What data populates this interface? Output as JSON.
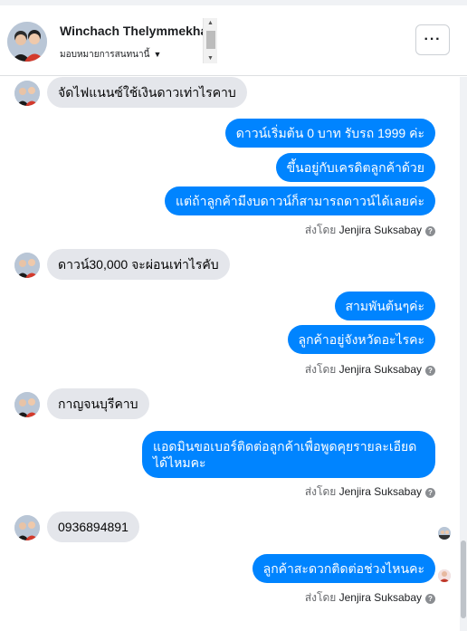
{
  "header": {
    "name": "Winchach Thelymmekha",
    "assign_label": "มอบหมายการสนทนานี้",
    "caret_icon": "caret-down-icon",
    "more_label": "···"
  },
  "messages": {
    "m1": "จัดไฟแนนซ์ใช้เงินดาวเท่าไรคาบ",
    "m2": "ดาวน์เริ่มต้น 0 บาท รับรถ 1999 ค่ะ",
    "m3": "ขึ้นอยู่กับเครดิตลูกค้าด้วย",
    "m4": "แต่ถ้าลูกค้ามีงบดาวน์ก็สามารถดาวน์ได้เลยค่ะ",
    "m5": "ดาวน์30,000  จะผ่อนเท่าไรคับ",
    "m6": "สามพันต้นๆค่ะ",
    "m7": "ลูกค้าอยู่จังหวัดอะไรคะ",
    "m8": "กาญจนบุรีคาบ",
    "m9": "แอดมินขอเบอร์ติดต่อลูกค้าเพื่อพูดคุยรายละเอียดได้ไหมคะ",
    "m10": "0936894891",
    "m11": "ลูกค้าสะดวกติดต่อช่วงไหนคะ"
  },
  "sent_by": {
    "prefix": "ส่งโดย",
    "agent": "Jenjira Suksabay",
    "help_glyph": "?"
  }
}
